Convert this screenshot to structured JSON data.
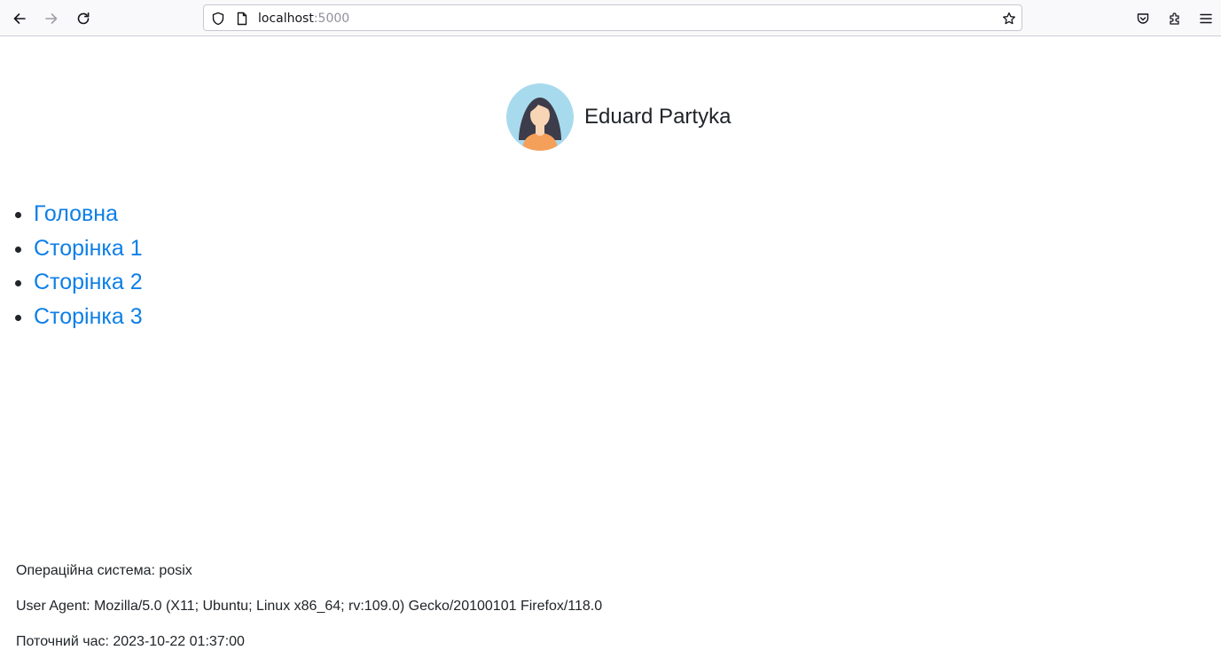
{
  "browser": {
    "url_host": "localhost",
    "url_port": ":5000",
    "icons": {
      "back": "arrow-left-icon",
      "forward": "arrow-right-icon",
      "reload": "reload-icon",
      "site_security": "shield-icon",
      "page": "page-icon",
      "bookmark": "star-icon",
      "pocket": "pocket-icon",
      "extensions": "puzzle-icon",
      "menu": "hamburger-menu-icon"
    }
  },
  "header": {
    "avatar_icon": "woman-avatar-icon",
    "user_name": "Eduard Partyka"
  },
  "nav": {
    "items": [
      {
        "label": "Головна"
      },
      {
        "label": "Сторінка 1"
      },
      {
        "label": "Сторінка 2"
      },
      {
        "label": "Сторінка 3"
      }
    ]
  },
  "footer": {
    "os": "Операційна система: posix",
    "user_agent": "User Agent: Mozilla/5.0 (X11; Ubuntu; Linux x86_64; rv:109.0) Gecko/20100101 Firefox/118.0",
    "current_time": "Поточний час: 2023-10-22 01:37:00"
  },
  "colors": {
    "link": "#0d7fe6",
    "text": "#212529",
    "avatar_bg": "#a8daee"
  }
}
